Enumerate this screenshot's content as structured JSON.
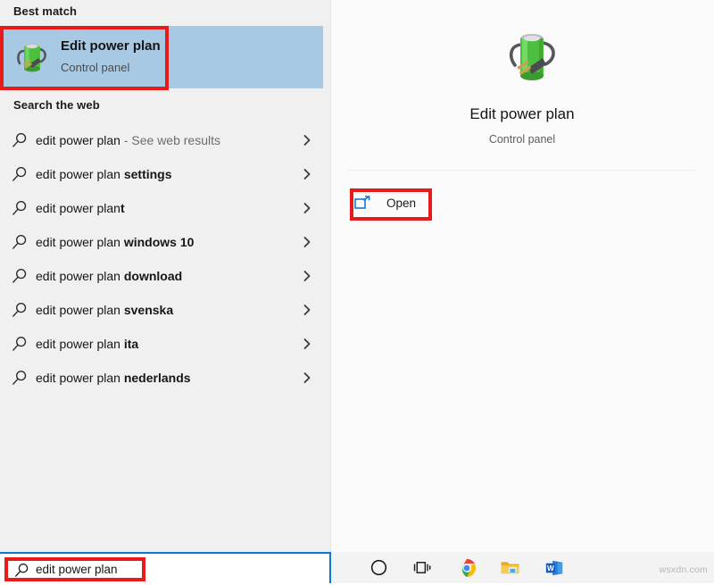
{
  "panel": {
    "best_match_header": "Best match",
    "search_web_header": "Search the web"
  },
  "best_match": {
    "title": "Edit power plan",
    "subtitle": "Control panel",
    "icon": "power-plan-battery-icon"
  },
  "suggestions": [
    {
      "prefix": "edit power plan",
      "suffix": " - See web results",
      "suffix_style": "muted",
      "icon": "search-icon",
      "chevron": "chevron-right-icon"
    },
    {
      "prefix": "edit power plan ",
      "suffix": "settings",
      "suffix_style": "bold",
      "icon": "search-icon",
      "chevron": "chevron-right-icon"
    },
    {
      "prefix": "edit power plan",
      "suffix": "t",
      "suffix_style": "bold",
      "icon": "search-icon",
      "chevron": "chevron-right-icon"
    },
    {
      "prefix": "edit power plan ",
      "suffix": "windows 10",
      "suffix_style": "bold",
      "icon": "search-icon",
      "chevron": "chevron-right-icon"
    },
    {
      "prefix": "edit power plan ",
      "suffix": "download",
      "suffix_style": "bold",
      "icon": "search-icon",
      "chevron": "chevron-right-icon"
    },
    {
      "prefix": "edit power plan ",
      "suffix": "svenska",
      "suffix_style": "bold",
      "icon": "search-icon",
      "chevron": "chevron-right-icon"
    },
    {
      "prefix": "edit power plan ",
      "suffix": "ita",
      "suffix_style": "bold",
      "icon": "search-icon",
      "chevron": "chevron-right-icon"
    },
    {
      "prefix": "edit power plan ",
      "suffix": "nederlands",
      "suffix_style": "bold",
      "icon": "search-icon",
      "chevron": "chevron-right-icon"
    }
  ],
  "preview": {
    "title": "Edit power plan",
    "subtitle": "Control panel",
    "icon": "power-plan-battery-icon",
    "open_label": "Open",
    "open_icon": "open-external-icon"
  },
  "taskbar": {
    "search_value": "edit power plan",
    "search_icon": "search-icon",
    "items": [
      {
        "name": "cortana-icon"
      },
      {
        "name": "task-view-icon"
      },
      {
        "name": "chrome-icon"
      },
      {
        "name": "file-explorer-icon"
      },
      {
        "name": "word-icon"
      }
    ]
  },
  "watermark": "wsxdn.com",
  "colors": {
    "selection_blue": "#a8c9e4",
    "annotation_red": "#e81b1b",
    "accent_blue": "#0b7ad4",
    "left_pane_bg": "#f0f0f0",
    "right_pane_bg": "#fbfbfb"
  }
}
